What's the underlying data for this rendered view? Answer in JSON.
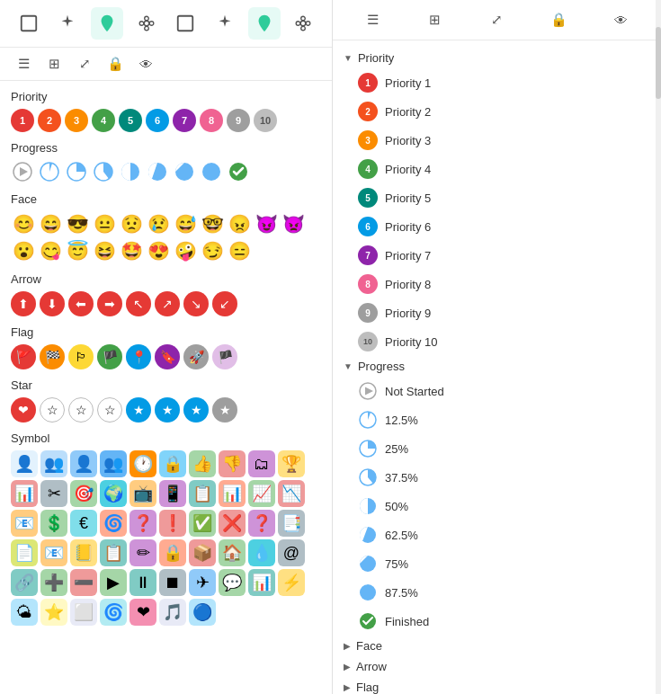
{
  "left_panel": {
    "icon_bar": [
      {
        "name": "square-icon",
        "symbol": "⊡",
        "active": false
      },
      {
        "name": "sparkle-icon",
        "symbol": "✦",
        "active": false
      },
      {
        "name": "location-icon",
        "symbol": "📍",
        "active": true
      },
      {
        "name": "flower-icon",
        "symbol": "✿",
        "active": false
      },
      {
        "name": "square2-icon",
        "symbol": "⊡",
        "active": false
      },
      {
        "name": "sparkle2-icon",
        "symbol": "✦",
        "active": false
      },
      {
        "name": "location2-icon",
        "symbol": "📍",
        "active": true
      },
      {
        "name": "flower2-icon",
        "symbol": "✿",
        "active": false
      }
    ],
    "toolbar": [
      "list",
      "grid",
      "expand",
      "lock",
      "eye"
    ],
    "sections": {
      "priority": {
        "label": "Priority",
        "items": [
          {
            "number": 1,
            "color": "#e53935"
          },
          {
            "number": 2,
            "color": "#f4511e"
          },
          {
            "number": 3,
            "color": "#fb8c00"
          },
          {
            "number": 4,
            "color": "#43a047"
          },
          {
            "number": 5,
            "color": "#00897b"
          },
          {
            "number": 6,
            "color": "#039be5"
          },
          {
            "number": 7,
            "color": "#8e24aa"
          },
          {
            "number": 8,
            "color": "#f06292"
          },
          {
            "number": 9,
            "color": "#9e9e9e"
          },
          {
            "number": 10,
            "color": "#bdbdbd",
            "text_color": "#555"
          }
        ]
      },
      "progress": {
        "label": "Progress",
        "items": [
          "▷",
          "◔",
          "◑",
          "◕",
          "●",
          "◑",
          "◑",
          "◑",
          "✓"
        ]
      },
      "face": {
        "label": "Face",
        "emojis": [
          "😊",
          "😄",
          "😎",
          "😐",
          "😟",
          "😢",
          "😅",
          "🤓",
          "😠",
          "😈",
          "👿",
          "😮",
          "😋",
          "😇",
          "😆",
          "🤩",
          "😍",
          "🤪",
          "😏",
          "😑"
        ]
      },
      "arrow": {
        "label": "Arrow",
        "items": [
          "⬆",
          "⬇",
          "⬅",
          "➡",
          "↖",
          "↗",
          "↘",
          "↙"
        ]
      },
      "flag": {
        "label": "Flag",
        "items": [
          "🚩",
          "🏁",
          "🏳",
          "🏴",
          "📍",
          "🔖",
          "🚀",
          "🏴"
        ]
      },
      "star": {
        "label": "Star",
        "items": [
          "❤",
          "☆",
          "★",
          "✩",
          "✪",
          "✫",
          "✬",
          "✭"
        ]
      },
      "symbol": {
        "label": "Symbol",
        "rows": [
          [
            "👤",
            "👥",
            "👤",
            "👥",
            "🕐",
            "🔒",
            "👍",
            "👎",
            "🗂",
            "🏆"
          ],
          [
            "📊",
            "✂",
            "🎯",
            "🌍",
            "📺",
            "📱",
            "📋",
            "📊",
            "📈",
            "📉"
          ],
          [
            "📧",
            "💲",
            "€",
            "🌀",
            "❓",
            "❗",
            "✅",
            "❌",
            "❓",
            "📑",
            "📄"
          ],
          [
            "📧",
            "📒",
            "📋",
            "✏",
            "🔒",
            "📦",
            "🏠",
            "💧",
            "@",
            "🔗",
            "➕"
          ],
          [
            "➖",
            "▶",
            "⏸",
            "⏹",
            "✈",
            "💬",
            "📊",
            "⚡",
            "🌤",
            "⭐"
          ],
          [
            "⬜",
            "🌀",
            "❤",
            "🎵",
            "🔵"
          ]
        ]
      }
    }
  },
  "right_panel": {
    "icon_bar": [
      {
        "name": "list-icon",
        "active": false
      },
      {
        "name": "grid-icon",
        "active": false
      },
      {
        "name": "expand-icon",
        "active": false
      },
      {
        "name": "lock-icon",
        "active": false
      },
      {
        "name": "eye-icon",
        "active": false
      }
    ],
    "sections": [
      {
        "label": "Priority",
        "expanded": true,
        "items": [
          {
            "text": "Priority 1",
            "color": "#e53935",
            "number": 1
          },
          {
            "text": "Priority 2",
            "color": "#f4511e",
            "number": 2
          },
          {
            "text": "Priority 3",
            "color": "#fb8c00",
            "number": 3
          },
          {
            "text": "Priority 4",
            "color": "#43a047",
            "number": 4
          },
          {
            "text": "Priority 5",
            "color": "#00897b",
            "number": 5
          },
          {
            "text": "Priority 6",
            "color": "#039be5",
            "number": 6
          },
          {
            "text": "Priority 7",
            "color": "#8e24aa",
            "number": 7
          },
          {
            "text": "Priority 8",
            "color": "#f06292",
            "number": 8
          },
          {
            "text": "Priority 9",
            "color": "#9e9e9e",
            "number": 9
          },
          {
            "text": "Priority 10",
            "color": "#bdbdbd",
            "number": 10
          }
        ]
      },
      {
        "label": "Progress",
        "expanded": true,
        "items": [
          {
            "text": "Not Started",
            "icon": "not-started"
          },
          {
            "text": "12.5%",
            "icon": "12.5"
          },
          {
            "text": "25%",
            "icon": "25"
          },
          {
            "text": "37.5%",
            "icon": "37.5"
          },
          {
            "text": "50%",
            "icon": "50"
          },
          {
            "text": "62.5%",
            "icon": "62.5"
          },
          {
            "text": "75%",
            "icon": "75"
          },
          {
            "text": "87.5%",
            "icon": "87.5"
          },
          {
            "text": "Finished",
            "icon": "finished"
          }
        ]
      },
      {
        "label": "Face",
        "expanded": false,
        "items": []
      },
      {
        "label": "Arrow",
        "expanded": false,
        "items": []
      },
      {
        "label": "Flag",
        "expanded": false,
        "items": []
      }
    ]
  }
}
